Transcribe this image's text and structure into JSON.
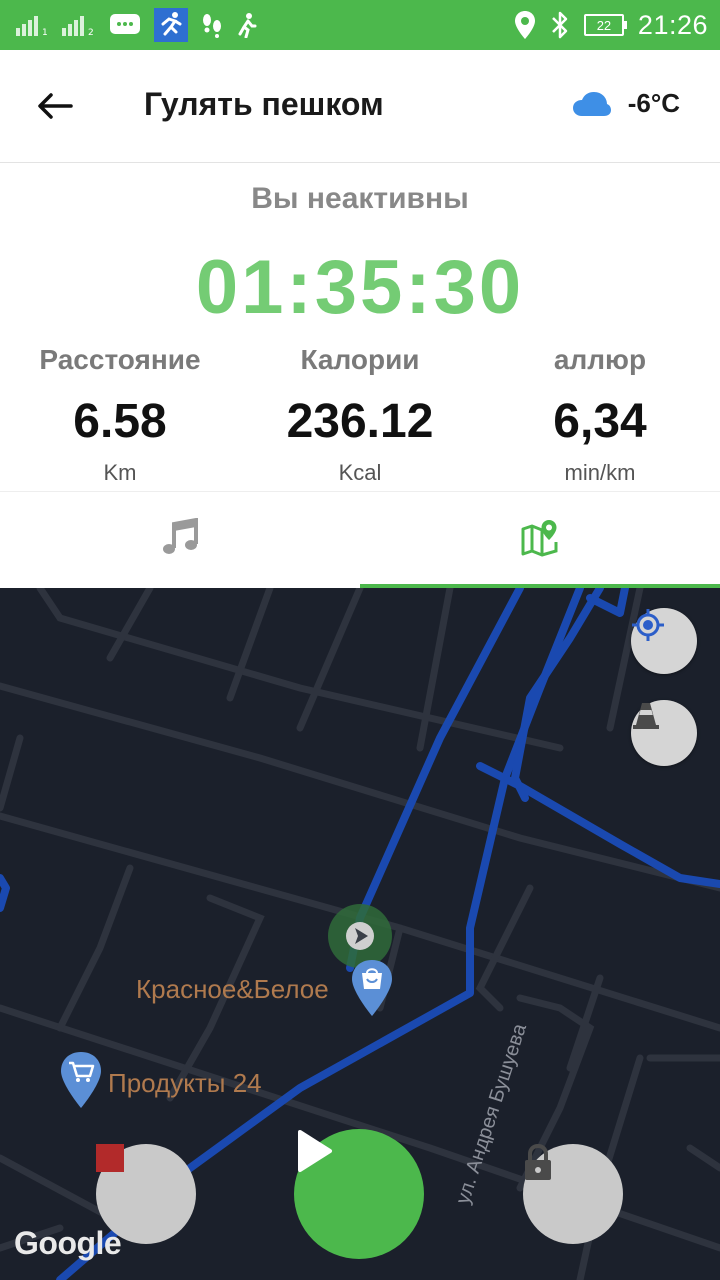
{
  "status_bar": {
    "time": "21:26",
    "battery_level": "22",
    "icons": [
      "signal-1-icon",
      "signal-2-icon",
      "message-icon",
      "running-app-icon",
      "footsteps-icon",
      "walking-icon",
      "location-icon",
      "bluetooth-icon",
      "battery-icon"
    ]
  },
  "header": {
    "title": "Гулять пешком",
    "back_icon": "arrow-left-icon",
    "weather_icon": "cloud-icon",
    "temperature": "-6°C"
  },
  "workout": {
    "status": "Вы неактивны",
    "timer": "01:35:30",
    "stats": [
      {
        "label": "Расстояние",
        "value": "6.58",
        "unit": "Km"
      },
      {
        "label": "Калории",
        "value": "236.12",
        "unit": "Kcal"
      },
      {
        "label": "аллюр",
        "value": "6,34",
        "unit": "min/km"
      }
    ]
  },
  "tabs": [
    {
      "icon": "music-note-icon",
      "active": false
    },
    {
      "icon": "map-pin-icon",
      "active": true
    }
  ],
  "map": {
    "pois": [
      {
        "label": "Красное&Белое",
        "icon": "shopping-bag-icon"
      },
      {
        "label": "Продукты 24",
        "icon": "shopping-cart-icon"
      }
    ],
    "street_label": "ул. Андрея Бушуева",
    "attribution": "Google",
    "controls": [
      "my-location-icon",
      "traffic-cone-icon"
    ]
  },
  "controls": {
    "stop_icon": "stop-icon",
    "play_icon": "play-icon",
    "lock_icon": "lock-icon"
  },
  "colors": {
    "accent": "#4cb84c",
    "timer": "#74cc74",
    "route": "#1a49b0",
    "map_bg": "#1b202b",
    "stop": "#b22a2a"
  }
}
